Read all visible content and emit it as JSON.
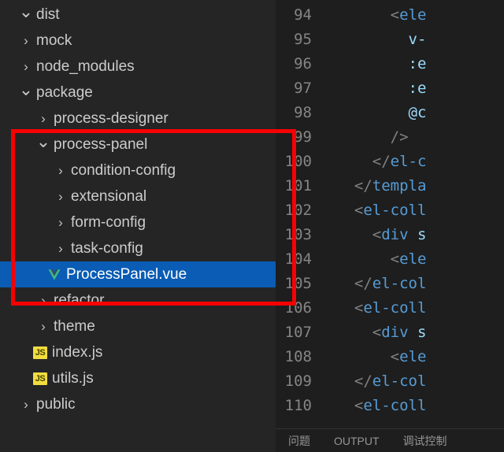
{
  "tree": {
    "items": [
      {
        "label": "dist",
        "indent": 24,
        "chev": "down",
        "icon": "none"
      },
      {
        "label": "mock",
        "indent": 24,
        "chev": "right",
        "icon": "none"
      },
      {
        "label": "node_modules",
        "indent": 24,
        "chev": "right",
        "icon": "none"
      },
      {
        "label": "package",
        "indent": 24,
        "chev": "down",
        "icon": "none"
      },
      {
        "label": "process-designer",
        "indent": 46,
        "chev": "right",
        "icon": "none"
      },
      {
        "label": "process-panel",
        "indent": 46,
        "chev": "down",
        "icon": "none"
      },
      {
        "label": "condition-config",
        "indent": 68,
        "chev": "right",
        "icon": "none"
      },
      {
        "label": "extensional",
        "indent": 68,
        "chev": "right",
        "icon": "none"
      },
      {
        "label": "form-config",
        "indent": 68,
        "chev": "right",
        "icon": "none"
      },
      {
        "label": "task-config",
        "indent": 68,
        "chev": "right",
        "icon": "none"
      },
      {
        "label": "ProcessPanel.vue",
        "indent": 58,
        "chev": "none",
        "icon": "vue",
        "selected": true
      },
      {
        "label": "refactor",
        "indent": 46,
        "chev": "right",
        "icon": "none"
      },
      {
        "label": "theme",
        "indent": 46,
        "chev": "right",
        "icon": "none"
      },
      {
        "label": "index.js",
        "indent": 40,
        "chev": "none",
        "icon": "js"
      },
      {
        "label": "utils.js",
        "indent": 40,
        "chev": "none",
        "icon": "js"
      },
      {
        "label": "public",
        "indent": 24,
        "chev": "right",
        "icon": "none"
      }
    ]
  },
  "editor": {
    "startLine": 94,
    "lines": [
      {
        "i": 22,
        "tokens": [
          {
            "t": "<",
            "c": "p"
          },
          {
            "t": "ele",
            "c": "tag"
          }
        ]
      },
      {
        "i": 24,
        "tokens": [
          {
            "t": "v-",
            "c": "attr"
          }
        ]
      },
      {
        "i": 24,
        "tokens": [
          {
            "t": ":e",
            "c": "attr"
          }
        ]
      },
      {
        "i": 24,
        "tokens": [
          {
            "t": ":e",
            "c": "attr"
          }
        ]
      },
      {
        "i": 24,
        "tokens": [
          {
            "t": "@c",
            "c": "attr"
          }
        ]
      },
      {
        "i": 22,
        "tokens": [
          {
            "t": "/>",
            "c": "p"
          }
        ]
      },
      {
        "i": 20,
        "tokens": [
          {
            "t": "</",
            "c": "p"
          },
          {
            "t": "el-c",
            "c": "tag"
          }
        ]
      },
      {
        "i": 18,
        "tokens": [
          {
            "t": "</",
            "c": "p"
          },
          {
            "t": "templa",
            "c": "tag"
          }
        ]
      },
      {
        "i": 18,
        "tokens": [
          {
            "t": "<",
            "c": "p"
          },
          {
            "t": "el-coll",
            "c": "tag"
          }
        ]
      },
      {
        "i": 20,
        "tokens": [
          {
            "t": "<",
            "c": "p"
          },
          {
            "t": "div",
            "c": "tag"
          },
          {
            "t": " s",
            "c": "attr"
          }
        ]
      },
      {
        "i": 22,
        "tokens": [
          {
            "t": "<",
            "c": "p"
          },
          {
            "t": "ele",
            "c": "tag"
          }
        ]
      },
      {
        "i": 18,
        "tokens": [
          {
            "t": "</",
            "c": "p"
          },
          {
            "t": "el-col",
            "c": "tag"
          }
        ]
      },
      {
        "i": 18,
        "tokens": [
          {
            "t": "<",
            "c": "p"
          },
          {
            "t": "el-coll",
            "c": "tag"
          }
        ]
      },
      {
        "i": 20,
        "tokens": [
          {
            "t": "<",
            "c": "p"
          },
          {
            "t": "div",
            "c": "tag"
          },
          {
            "t": " s",
            "c": "attr"
          }
        ]
      },
      {
        "i": 22,
        "tokens": [
          {
            "t": "<",
            "c": "p"
          },
          {
            "t": "ele",
            "c": "tag"
          }
        ]
      },
      {
        "i": 18,
        "tokens": [
          {
            "t": "</",
            "c": "p"
          },
          {
            "t": "el-col",
            "c": "tag"
          }
        ]
      },
      {
        "i": 18,
        "tokens": [
          {
            "t": "<",
            "c": "p"
          },
          {
            "t": "el-coll",
            "c": "tag"
          }
        ]
      }
    ]
  },
  "bottomTabs": {
    "problems": "问题",
    "output": "OUTPUT",
    "debug": "调试控制"
  }
}
